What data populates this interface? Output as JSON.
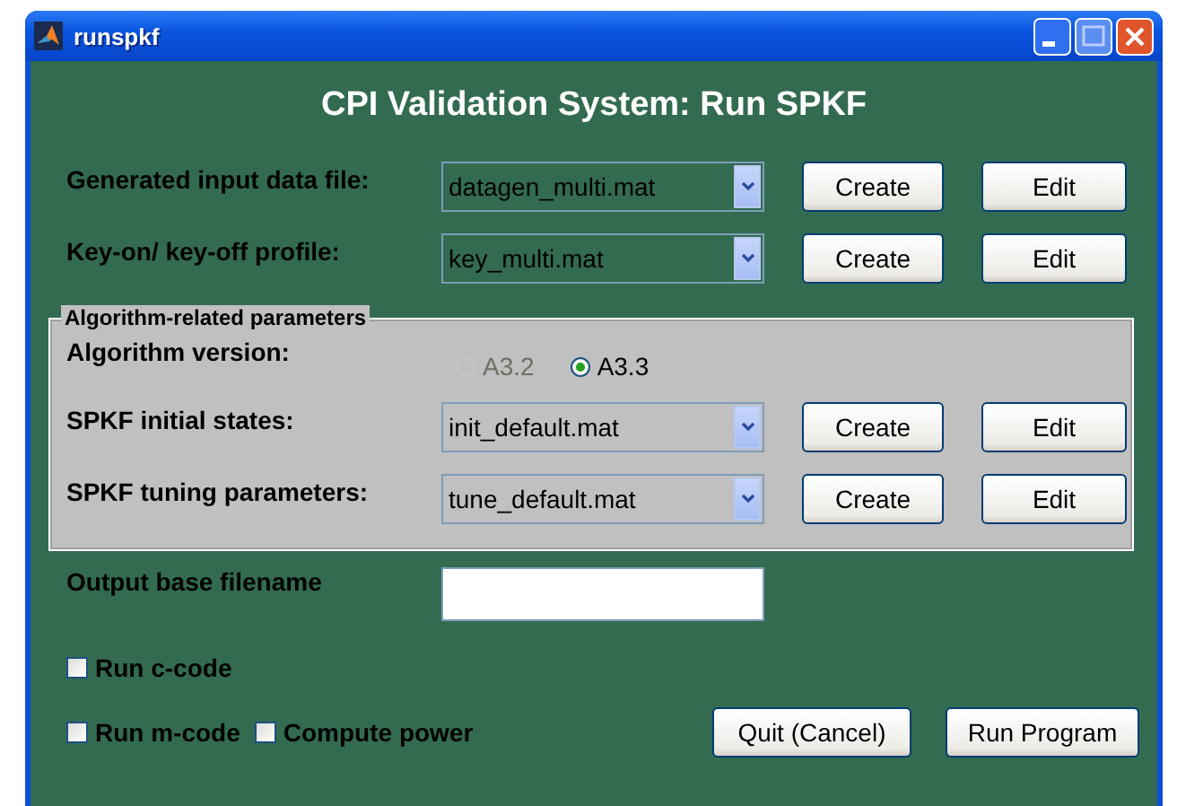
{
  "window": {
    "title": "runspkf"
  },
  "heading": "CPI Validation System: Run SPKF",
  "file_rows": [
    {
      "label": "Generated input data file:",
      "value": "datagen_multi.mat",
      "buttons": [
        "Create",
        "Edit"
      ]
    },
    {
      "label": "Key-on/ key-off profile:",
      "value": "key_multi.mat",
      "buttons": [
        "Create",
        "Edit"
      ]
    }
  ],
  "group": {
    "title": "Algorithm-related parameters",
    "algorithm_version": {
      "label": "Algorithm version:",
      "options": [
        {
          "label": "A3.2",
          "selected": false,
          "disabled": true
        },
        {
          "label": "A3.3",
          "selected": true,
          "disabled": false
        }
      ]
    },
    "file_rows": [
      {
        "label": "SPKF initial states:",
        "value": "init_default.mat",
        "buttons": [
          "Create",
          "Edit"
        ]
      },
      {
        "label": "SPKF tuning parameters:",
        "value": "tune_default.mat",
        "buttons": [
          "Create",
          "Edit"
        ]
      }
    ]
  },
  "output": {
    "label": "Output base filename"
  },
  "checkbox_rows": [
    {
      "checkboxes": [
        {
          "label": "Run c-code",
          "checked": false
        }
      ],
      "buttons": []
    },
    {
      "checkboxes": [
        {
          "label": "Run m-code",
          "checked": false
        },
        {
          "label": "Compute power",
          "checked": false
        }
      ],
      "buttons": [
        "Quit (Cancel)",
        "Run Program"
      ]
    }
  ]
}
